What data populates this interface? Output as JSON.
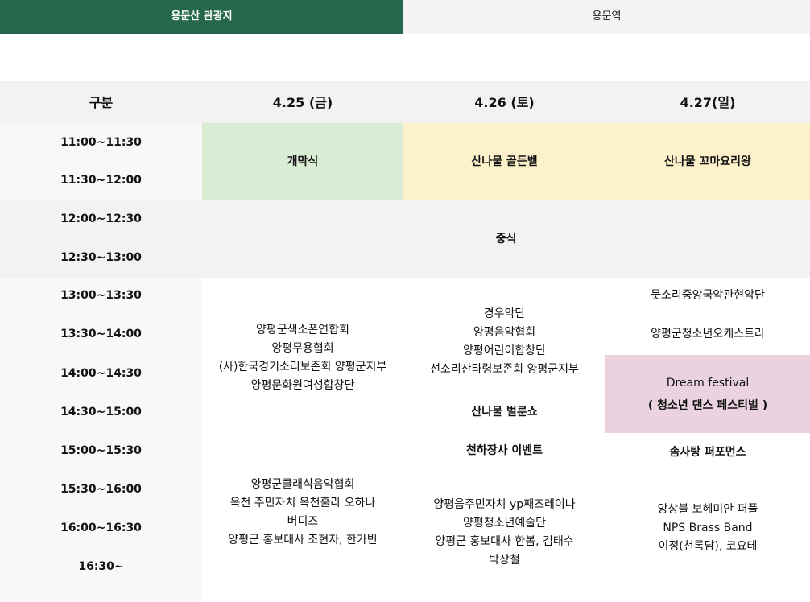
{
  "tabs": {
    "active": "용문산 관광지",
    "inactive": "용문역"
  },
  "table": {
    "header": {
      "label": "구분",
      "day1": "4.25 (금)",
      "day2": "4.26 (토)",
      "day3": "4.27(일)"
    },
    "times": [
      "11:00~11:30",
      "11:30~12:00",
      "12:00~12:30",
      "12:30~13:00",
      "13:00~13:30",
      "13:30~14:00",
      "14:00~14:30",
      "14:30~15:00",
      "15:00~15:30",
      "15:30~16:00",
      "16:00~16:30",
      "16:30~"
    ],
    "opening": "개막식",
    "golden_bell": "산나물 골든벨",
    "cooking_king": "산나물 꼬마요리왕",
    "lunch": "중식",
    "day1_afternoon": [
      "양평군색소폰연합회",
      "양평무용협회",
      "(사)한국경기소리보존회 양평군지부",
      "양평문화원여성합창단"
    ],
    "day1_late": [
      "양평군클래식음악협회",
      "옥천 주민자치 옥천훌라 오하나",
      "버디즈",
      "양평군 홍보대사 조현자, 한가빈"
    ],
    "day2_afternoon": [
      "경우악단",
      "양평음악협회",
      "양평어린이합창단",
      "선소리산타령보존회 양평군지부"
    ],
    "day2_bugshow": "산나물 벌룬쇼",
    "day2_event": "천하장사 이벤트",
    "day2_late": [
      "양평읍주민자치 yp째즈레이나",
      "양평청소년예술단",
      "양평군 홍보대사 한봄, 김태수",
      "박상철"
    ],
    "day3_row1": "뭇소리중앙국악관현악단",
    "day3_row2": "양평군청소년오케스트라",
    "day3_festival_title": "Dream festival",
    "day3_festival_sub": "( 청소년 댄스 페스티벌 )",
    "day3_performance": "솜사탕 퍼포먼스",
    "day3_late": [
      "앙상블 보헤미안 퍼플",
      "NPS Brass Band",
      "이정(천록담), 코요테"
    ]
  }
}
